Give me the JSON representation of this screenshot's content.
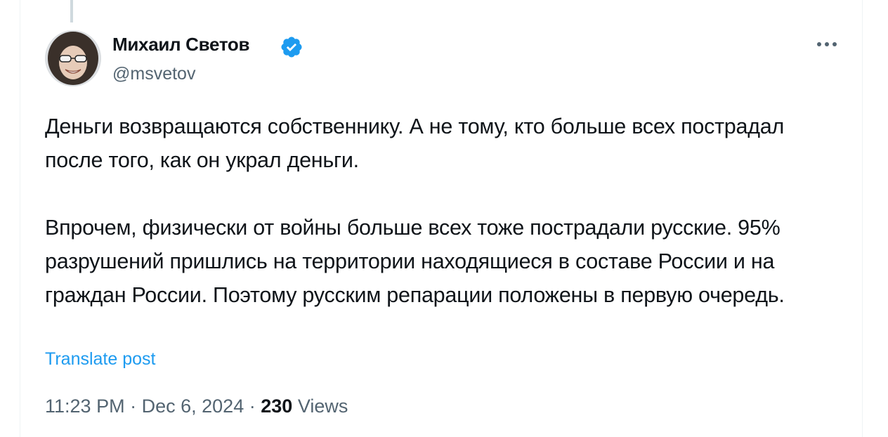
{
  "post": {
    "author": {
      "name": "Михаил Светов",
      "handle": "@msvetov",
      "verified": true,
      "verified_color": "#1d9bf0"
    },
    "paragraphs": [
      "Деньги возвращаются собственнику. А не тому, кто больше всех пострадал после того, как он украл деньги.",
      "Впрочем, физически от войны больше всех тоже пострадали русские. 95% разрушений пришлись на территории находящиеся в составе России и на граждан России. Поэтому русским репарации положены в первую очередь."
    ],
    "translate_label": "Translate post",
    "time": "11:23 PM",
    "separator": "·",
    "date": "Dec 6, 2024",
    "views_count": "230",
    "views_label": "Views"
  },
  "colors": {
    "accent": "#1d9bf0",
    "text": "#0f1419",
    "secondary": "#536471"
  },
  "icons": {
    "verified": "verified-badge-icon",
    "more": "more-options-icon"
  }
}
